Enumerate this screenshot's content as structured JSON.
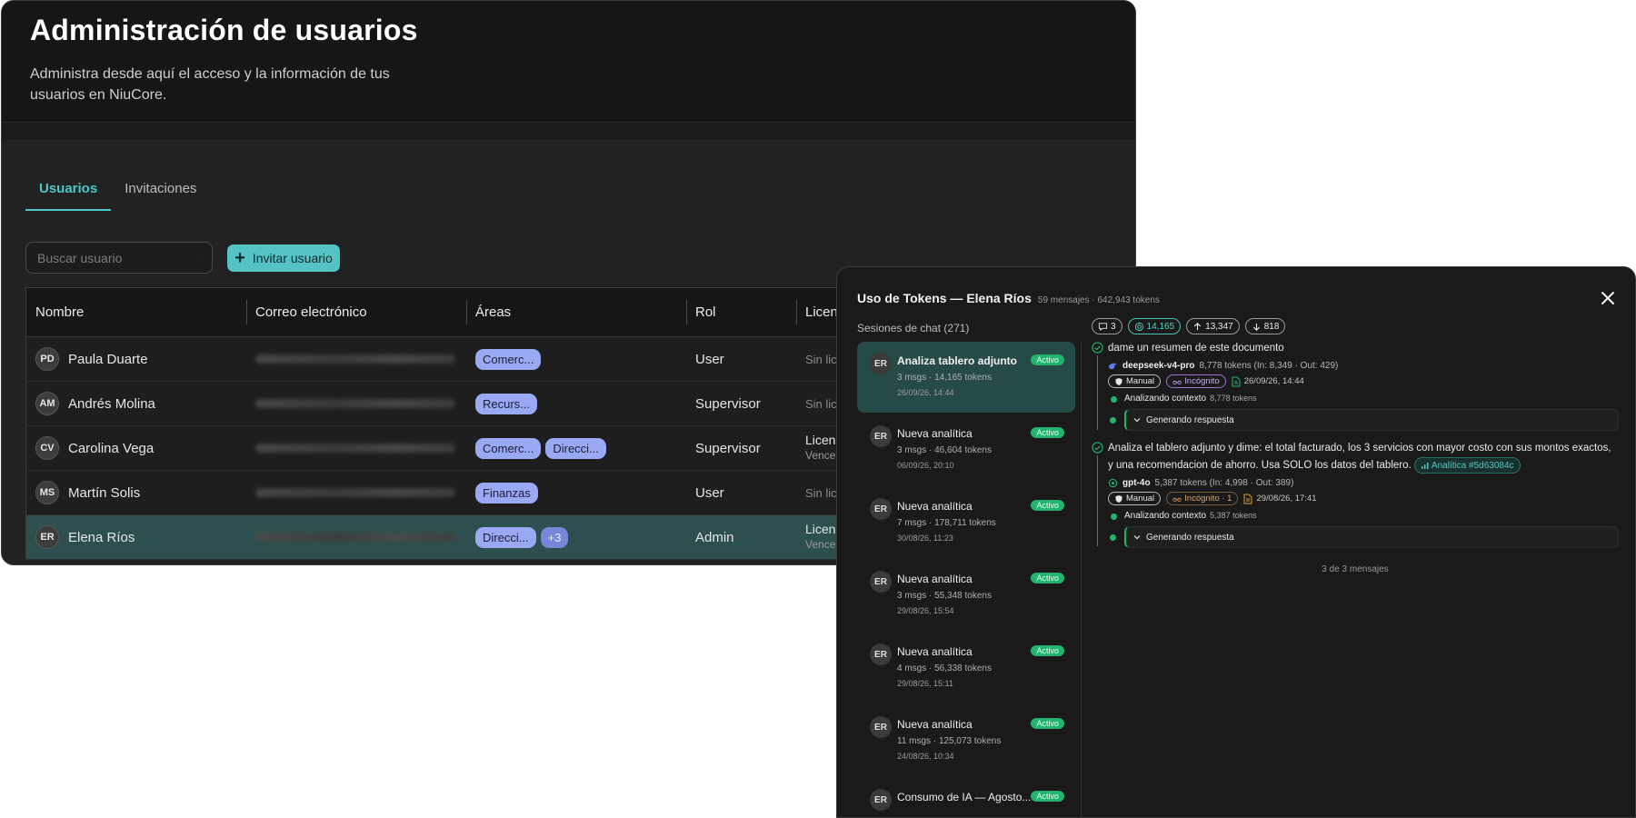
{
  "admin": {
    "title": "Administración de usuarios",
    "subtitle": "Administra desde aquí el acceso y la información de tus usuarios en NiuCore.",
    "tabs": [
      {
        "label": "Usuarios",
        "active": true
      },
      {
        "label": "Invitaciones",
        "active": false
      }
    ],
    "search_placeholder": "Buscar usuario",
    "invite_label": "Invitar usuario",
    "columns": [
      "Nombre",
      "Correo electrónico",
      "Áreas",
      "Rol",
      "Licen"
    ],
    "rows": [
      {
        "initials": "PD",
        "name": "Paula Duarte",
        "areas": [
          "Comerc..."
        ],
        "more": "",
        "role": "User",
        "license": "Sin lice",
        "license_sub": ""
      },
      {
        "initials": "AM",
        "name": "Andrés Molina",
        "areas": [
          "Recurs..."
        ],
        "more": "",
        "role": "Supervisor",
        "license": "Sin lice",
        "license_sub": ""
      },
      {
        "initials": "CV",
        "name": "Carolina Vega",
        "areas": [
          "Comerc...",
          "Direcci..."
        ],
        "more": "",
        "role": "Supervisor",
        "license": "Licenc",
        "license_sub": "Vence :"
      },
      {
        "initials": "MS",
        "name": "Martín Solis",
        "areas": [
          "Finanzas"
        ],
        "more": "",
        "role": "User",
        "license": "Sin lice",
        "license_sub": ""
      },
      {
        "initials": "ER",
        "name": "Elena Ríos",
        "areas": [
          "Direcci..."
        ],
        "more": "+3",
        "role": "Admin",
        "license": "Licenc",
        "license_sub": "Vence :",
        "selected": true
      }
    ]
  },
  "modal": {
    "title": "Uso de Tokens — Elena Ríos",
    "meta": "59 mensajes · 642,943 tokens",
    "sessions_label": "Sesiones de chat (271)",
    "sessions": [
      {
        "initials": "ER",
        "title": "Analiza tablero adjunto",
        "badge": "Activo",
        "info": "3 msgs · 14,165 tokens",
        "date": "26/09/26, 14:44",
        "active": true
      },
      {
        "initials": "ER",
        "title": "Nueva analítica",
        "badge": "Activo",
        "info": "3 msgs · 46,604 tokens",
        "date": "06/09/26, 20:10"
      },
      {
        "initials": "ER",
        "title": "Nueva analítica",
        "badge": "Activo",
        "info": "7 msgs · 178,711 tokens",
        "date": "30/08/26, 11:23"
      },
      {
        "initials": "ER",
        "title": "Nueva analítica",
        "badge": "Activo",
        "info": "3 msgs · 55,348 tokens",
        "date": "29/08/26, 15:54"
      },
      {
        "initials": "ER",
        "title": "Nueva analítica",
        "badge": "Activo",
        "info": "4 msgs · 56,338 tokens",
        "date": "29/08/26, 15:11"
      },
      {
        "initials": "ER",
        "title": "Nueva analítica",
        "badge": "Activo",
        "info": "11 msgs · 125,073 tokens",
        "date": "24/08/26, 10:34"
      },
      {
        "initials": "ER",
        "title": "Consumo de IA — Agosto...",
        "badge": "Activo",
        "info": "",
        "date": ""
      }
    ],
    "stats": {
      "messages": "3",
      "total": "14,165",
      "in": "13,347",
      "out": "818"
    },
    "messages": [
      {
        "text": "dame un resumen de este documento",
        "ref": "",
        "model": "deepseek-v4-pro",
        "model_tokens": "8,778 tokens (In: 8,349 · Out: 429)",
        "tag_manual": "Manual",
        "tag_incognito": "Incógnito",
        "doc_date": "26/09/26, 14:44",
        "step": "Analizando contexto",
        "step_tokens": "8,778 tokens",
        "generating": "Generando respuesta"
      },
      {
        "text": "Analiza el tablero adjunto y dime: el total facturado, los 3 servicios con mayor costo con sus montos exactos, y una recomendacion de ahorro. Usa SOLO los datos del tablero.",
        "ref": "Analítica #5d63084c",
        "model": "gpt-4o",
        "model_tokens": "5,387 tokens (In: 4,998 · Out: 389)",
        "tag_manual": "Manual",
        "tag_incognito": "Incógnito · 1",
        "doc_date": "29/08/26, 17:41",
        "step": "Analizando contexto",
        "step_tokens": "5,387 tokens",
        "generating": "Generando respuesta"
      }
    ],
    "footer": "3 de 3 mensajes"
  },
  "colors": {
    "accent": "#4fc7c7",
    "active_green": "#21b36c",
    "chip": "#9aa9f4",
    "selected_row": "#2e4f4f"
  }
}
